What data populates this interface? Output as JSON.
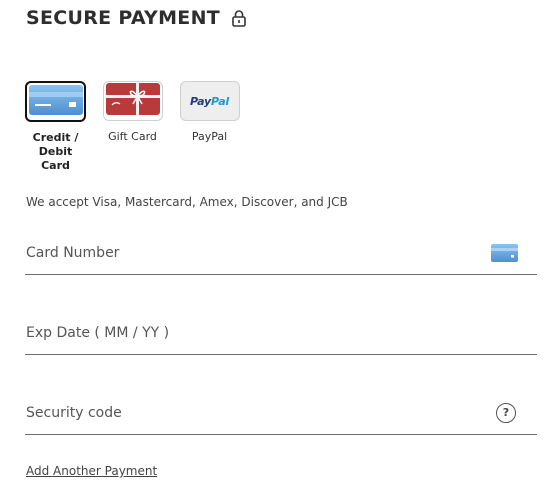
{
  "header": {
    "title": "SECURE PAYMENT",
    "lock_icon": "lock-icon"
  },
  "payment_methods": [
    {
      "label": "Credit / Debit Card",
      "icon": "credit-card-icon",
      "selected": true
    },
    {
      "label": "Gift Card",
      "icon": "gift-card-icon",
      "selected": false
    },
    {
      "label": "PayPal",
      "icon": "paypal-icon",
      "selected": false,
      "logo_text": "PayPal"
    }
  ],
  "accepted_cards_text": "We accept Visa, Mastercard, Amex, Discover, and JCB",
  "fields": {
    "card_number": {
      "placeholder": "Card Number",
      "value": "",
      "icon": "card-icon"
    },
    "exp_date": {
      "placeholder": "Exp Date ( MM / YY )",
      "value": ""
    },
    "security_code": {
      "placeholder": "Security code",
      "value": "",
      "help_icon": "help-icon",
      "help_glyph": "?"
    }
  },
  "add_payment_link": "Add Another Payment",
  "colors": {
    "card_blue": "#5b9bd5",
    "gift_red": "#b83a3a",
    "paypal_dark_blue": "#253b80",
    "paypal_light_blue": "#179bd7"
  }
}
